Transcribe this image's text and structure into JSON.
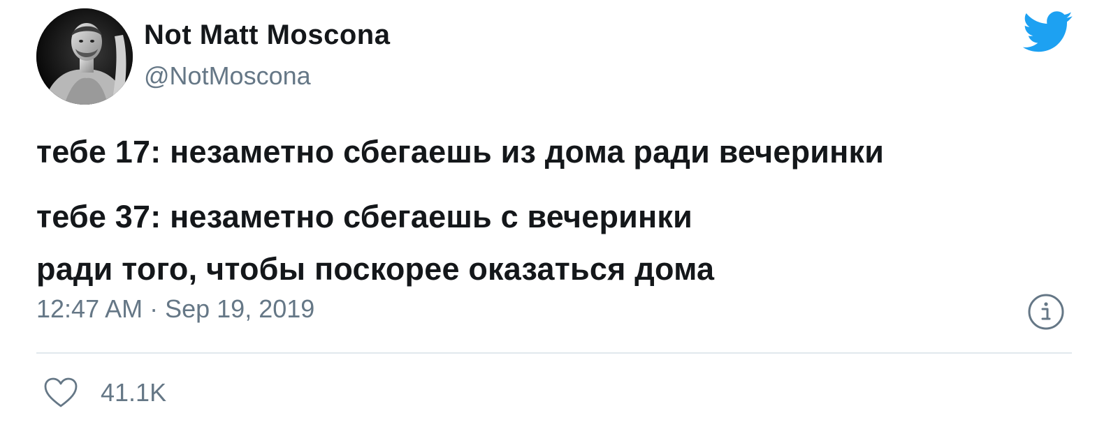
{
  "author": {
    "display_name": "Not Matt Moscona",
    "handle": "@NotMoscona"
  },
  "tweet": {
    "line1": "тебе 17: незаметно сбегаешь из дома ради вечеринки",
    "line2": "тебе 37: незаметно сбегаешь с вечеринки",
    "line3": "ради того, чтобы поскорее оказаться дома",
    "timestamp": "12:47 AM · Sep 19, 2019"
  },
  "actions": {
    "likes": "41.1K"
  },
  "icons": {
    "brand": "twitter-bird-icon",
    "info": "info-icon",
    "like": "heart-icon"
  },
  "colors": {
    "twitter_blue": "#1da1f2",
    "text_primary": "#14171a",
    "text_secondary": "#657786",
    "divider": "#e1e8ed"
  }
}
